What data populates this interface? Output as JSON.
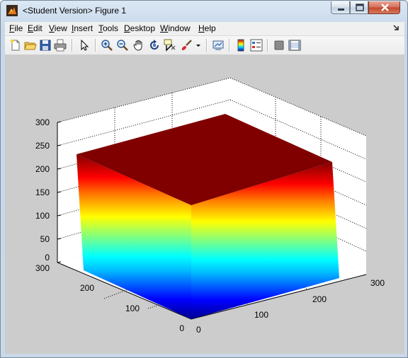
{
  "window": {
    "title": "<Student Version> Figure 1"
  },
  "menu": {
    "items": [
      "File",
      "Edit",
      "View",
      "Insert",
      "Tools",
      "Desktop",
      "Window",
      "Help"
    ]
  },
  "toolbar": {
    "icons": [
      "new-figure-icon",
      "open-file-icon",
      "save-icon",
      "print-icon",
      "edit-plot-arrow-icon",
      "zoom-in-icon",
      "zoom-out-icon",
      "pan-hand-icon",
      "rotate-3d-icon",
      "data-cursor-icon",
      "brush-icon",
      "link-plot-icon",
      "insert-colorbar-icon",
      "insert-legend-icon",
      "hide-plot-tools-icon",
      "show-plot-tools-icon"
    ]
  },
  "colors": {
    "figure_background": "#cccccc",
    "axes_background": "#ffffff",
    "box_top": "#800000"
  },
  "chart_data": {
    "type": "surface3d",
    "description_of_surface": "",
    "x_ticks": [
      "0",
      "100",
      "200",
      "300"
    ],
    "y_ticks": [
      "0",
      "100",
      "200",
      "300"
    ],
    "z_ticks": [
      "0",
      "50",
      "100",
      "150",
      "200",
      "250",
      "300"
    ],
    "xlim": [
      0,
      300
    ],
    "ylim": [
      0,
      300
    ],
    "zlim": [
      0,
      300
    ],
    "box_z_range": [
      0,
      255
    ],
    "colormap": "jet",
    "grid": true
  }
}
